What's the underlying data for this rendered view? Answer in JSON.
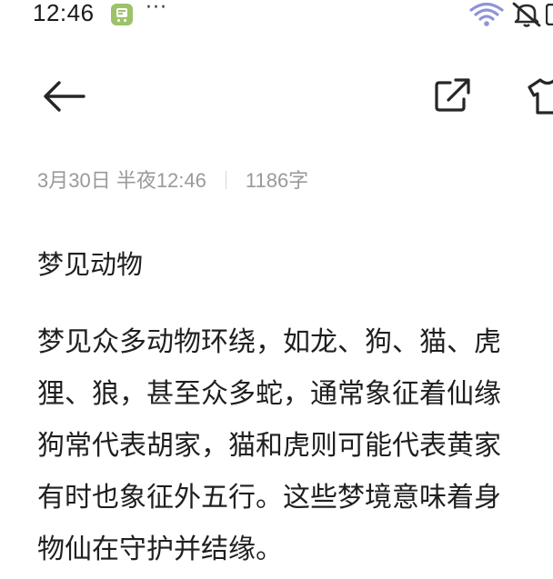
{
  "status_bar": {
    "time": "12:46",
    "dots": "···",
    "icons": [
      "app-notification-icon",
      "wifi-icon",
      "silent-icon",
      "battery-icon"
    ]
  },
  "toolbar": {
    "back": "back-arrow-icon",
    "share": "share-icon",
    "skin": "tshirt-skin-icon"
  },
  "note": {
    "date": "3月30日 半夜12:46",
    "word_count": "1186字",
    "title": "梦见动物",
    "lines": [
      "梦见众多动物环绕，如龙、狗、猫、虎",
      "狸、狼，甚至众多蛇，通常象征着仙缘",
      "狗常代表胡家，猫和虎则可能代表黄家",
      "有时也象征外五行。这些梦境意味着身",
      "物仙在守护并结缘。"
    ]
  },
  "colors": {
    "text": "#1f1f1f",
    "meta": "#9a9a9a",
    "app_icon": "#9cc26a",
    "wifi": "#8f93d8"
  }
}
